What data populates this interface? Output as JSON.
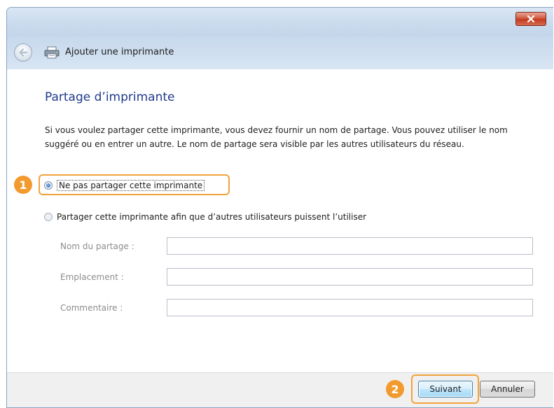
{
  "window": {
    "nav_title": "Ajouter une imprimante"
  },
  "page": {
    "title": "Partage d’imprimante",
    "description": "Si vous voulez partager cette imprimante, vous devez fournir un nom de partage. Vous pouvez utiliser le nom suggéré ou en entrer un autre. Le nom de partage sera visible par les autres utilisateurs du réseau."
  },
  "options": {
    "no_share_label": "Ne pas partager cette imprimante",
    "share_label": "Partager cette imprimante afin que d’autres utilisateurs puissent l’utiliser",
    "selected": "no_share"
  },
  "fields": {
    "share_name": {
      "label": "Nom du partage :",
      "value": ""
    },
    "location": {
      "label": "Emplacement :",
      "value": ""
    },
    "comment": {
      "label": "Commentaire :",
      "value": ""
    }
  },
  "buttons": {
    "next_label": "Suivant",
    "cancel_label": "Annuler"
  },
  "callouts": {
    "first": "1",
    "second": "2"
  },
  "colors": {
    "title_blue": "#1f3a8c",
    "callout_orange": "#f29a2e",
    "close_red": "#c23a1f"
  },
  "icons": {
    "close": "close-icon",
    "back": "back-arrow-icon",
    "printer": "printer-icon"
  }
}
